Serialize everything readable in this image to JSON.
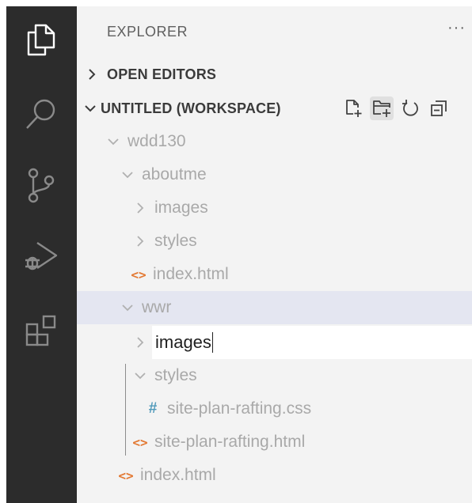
{
  "explorer": {
    "title": "EXPLORER",
    "more": "···"
  },
  "sections": {
    "open_editors": "OPEN EDITORS",
    "workspace": "UNTITLED (WORKSPACE)"
  },
  "tree": {
    "root": "wdd130",
    "aboutme": "aboutme",
    "aboutme_images": "images",
    "aboutme_styles": "styles",
    "aboutme_index": "index.html",
    "wwr": "wwr",
    "wwr_images_edit": "images",
    "wwr_styles": "styles",
    "css_file": "site-plan-rafting.css",
    "html_file": "site-plan-rafting.html",
    "root_index": "index.html"
  },
  "colors": {
    "activitybar": "#2c2c2c",
    "sidebar": "#f3f3f3",
    "selected_row": "#e4e6f1",
    "html_icon": "#e37933",
    "css_icon": "#519aba"
  }
}
